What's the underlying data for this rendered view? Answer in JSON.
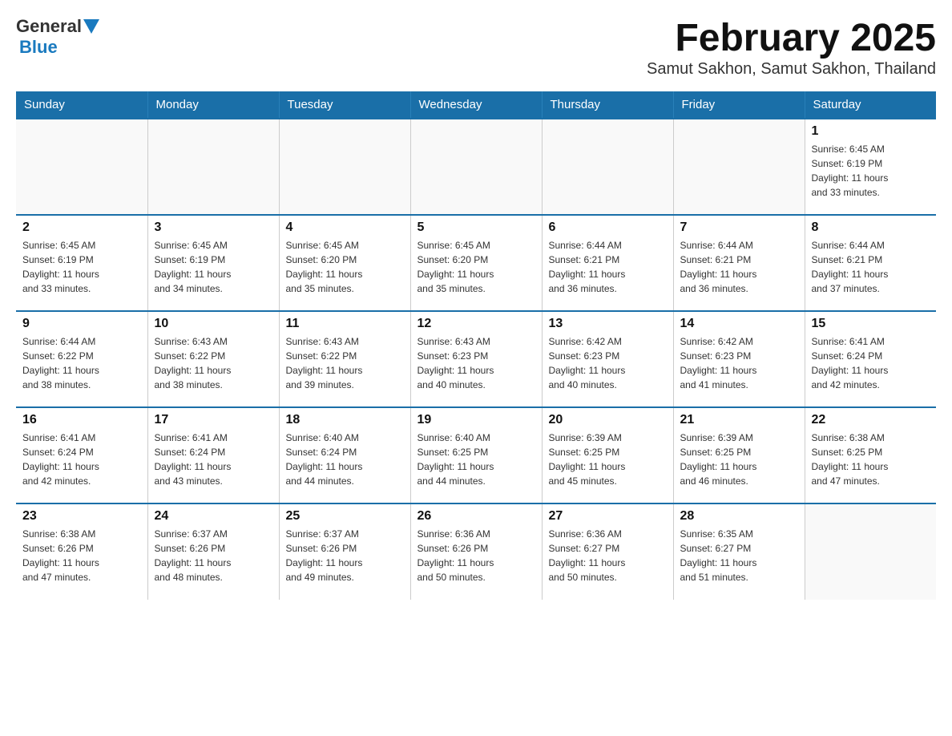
{
  "title": "February 2025",
  "subtitle": "Samut Sakhon, Samut Sakhon, Thailand",
  "logo": {
    "general": "General",
    "triangle": "▶",
    "blue": "Blue"
  },
  "weekdays": [
    "Sunday",
    "Monday",
    "Tuesday",
    "Wednesday",
    "Thursday",
    "Friday",
    "Saturday"
  ],
  "weeks": [
    [
      {
        "day": "",
        "info": ""
      },
      {
        "day": "",
        "info": ""
      },
      {
        "day": "",
        "info": ""
      },
      {
        "day": "",
        "info": ""
      },
      {
        "day": "",
        "info": ""
      },
      {
        "day": "",
        "info": ""
      },
      {
        "day": "1",
        "info": "Sunrise: 6:45 AM\nSunset: 6:19 PM\nDaylight: 11 hours\nand 33 minutes."
      }
    ],
    [
      {
        "day": "2",
        "info": "Sunrise: 6:45 AM\nSunset: 6:19 PM\nDaylight: 11 hours\nand 33 minutes."
      },
      {
        "day": "3",
        "info": "Sunrise: 6:45 AM\nSunset: 6:19 PM\nDaylight: 11 hours\nand 34 minutes."
      },
      {
        "day": "4",
        "info": "Sunrise: 6:45 AM\nSunset: 6:20 PM\nDaylight: 11 hours\nand 35 minutes."
      },
      {
        "day": "5",
        "info": "Sunrise: 6:45 AM\nSunset: 6:20 PM\nDaylight: 11 hours\nand 35 minutes."
      },
      {
        "day": "6",
        "info": "Sunrise: 6:44 AM\nSunset: 6:21 PM\nDaylight: 11 hours\nand 36 minutes."
      },
      {
        "day": "7",
        "info": "Sunrise: 6:44 AM\nSunset: 6:21 PM\nDaylight: 11 hours\nand 36 minutes."
      },
      {
        "day": "8",
        "info": "Sunrise: 6:44 AM\nSunset: 6:21 PM\nDaylight: 11 hours\nand 37 minutes."
      }
    ],
    [
      {
        "day": "9",
        "info": "Sunrise: 6:44 AM\nSunset: 6:22 PM\nDaylight: 11 hours\nand 38 minutes."
      },
      {
        "day": "10",
        "info": "Sunrise: 6:43 AM\nSunset: 6:22 PM\nDaylight: 11 hours\nand 38 minutes."
      },
      {
        "day": "11",
        "info": "Sunrise: 6:43 AM\nSunset: 6:22 PM\nDaylight: 11 hours\nand 39 minutes."
      },
      {
        "day": "12",
        "info": "Sunrise: 6:43 AM\nSunset: 6:23 PM\nDaylight: 11 hours\nand 40 minutes."
      },
      {
        "day": "13",
        "info": "Sunrise: 6:42 AM\nSunset: 6:23 PM\nDaylight: 11 hours\nand 40 minutes."
      },
      {
        "day": "14",
        "info": "Sunrise: 6:42 AM\nSunset: 6:23 PM\nDaylight: 11 hours\nand 41 minutes."
      },
      {
        "day": "15",
        "info": "Sunrise: 6:41 AM\nSunset: 6:24 PM\nDaylight: 11 hours\nand 42 minutes."
      }
    ],
    [
      {
        "day": "16",
        "info": "Sunrise: 6:41 AM\nSunset: 6:24 PM\nDaylight: 11 hours\nand 42 minutes."
      },
      {
        "day": "17",
        "info": "Sunrise: 6:41 AM\nSunset: 6:24 PM\nDaylight: 11 hours\nand 43 minutes."
      },
      {
        "day": "18",
        "info": "Sunrise: 6:40 AM\nSunset: 6:24 PM\nDaylight: 11 hours\nand 44 minutes."
      },
      {
        "day": "19",
        "info": "Sunrise: 6:40 AM\nSunset: 6:25 PM\nDaylight: 11 hours\nand 44 minutes."
      },
      {
        "day": "20",
        "info": "Sunrise: 6:39 AM\nSunset: 6:25 PM\nDaylight: 11 hours\nand 45 minutes."
      },
      {
        "day": "21",
        "info": "Sunrise: 6:39 AM\nSunset: 6:25 PM\nDaylight: 11 hours\nand 46 minutes."
      },
      {
        "day": "22",
        "info": "Sunrise: 6:38 AM\nSunset: 6:25 PM\nDaylight: 11 hours\nand 47 minutes."
      }
    ],
    [
      {
        "day": "23",
        "info": "Sunrise: 6:38 AM\nSunset: 6:26 PM\nDaylight: 11 hours\nand 47 minutes."
      },
      {
        "day": "24",
        "info": "Sunrise: 6:37 AM\nSunset: 6:26 PM\nDaylight: 11 hours\nand 48 minutes."
      },
      {
        "day": "25",
        "info": "Sunrise: 6:37 AM\nSunset: 6:26 PM\nDaylight: 11 hours\nand 49 minutes."
      },
      {
        "day": "26",
        "info": "Sunrise: 6:36 AM\nSunset: 6:26 PM\nDaylight: 11 hours\nand 50 minutes."
      },
      {
        "day": "27",
        "info": "Sunrise: 6:36 AM\nSunset: 6:27 PM\nDaylight: 11 hours\nand 50 minutes."
      },
      {
        "day": "28",
        "info": "Sunrise: 6:35 AM\nSunset: 6:27 PM\nDaylight: 11 hours\nand 51 minutes."
      },
      {
        "day": "",
        "info": ""
      }
    ]
  ]
}
